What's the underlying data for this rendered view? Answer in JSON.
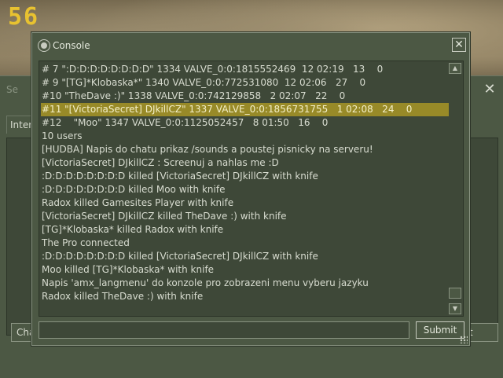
{
  "hud": {
    "number": "56"
  },
  "background_window": {
    "title": "Se",
    "tab_label": "Inter",
    "left_button_label": "Cha",
    "right_button_label": "t"
  },
  "console": {
    "title": "Console",
    "lines": [
      "# 7 \":D:D:D:D:D:D:D:D\" 1334 VALVE_0:0:1815552469  12 02:19   13    0",
      "# 9 \"[TG]*Klobaska*\" 1340 VALVE_0:0:772531080  12 02:06   27    0",
      "#10 \"TheDave :)\" 1338 VALVE_0:0:742129858   2 02:07   22    0",
      "#11 \"[VictoriaSecret] DJkillCZ\" 1337 VALVE_0:0:1856731755   1 02:08   24    0",
      "#12    \"Moo\" 1347 VALVE_0:0:1125052457   8 01:50   16    0",
      "10 users",
      "[HUDBA] Napis do chatu prikaz /sounds a poustej pisnicky na serveru!",
      "[VictoriaSecret] DJkillCZ : Screenuj a nahlas me :D",
      ":D:D:D:D:D:D:D:D killed [VictoriaSecret] DJkillCZ with knife",
      ":D:D:D:D:D:D:D:D killed Moo with knife",
      "Radox killed Gamesites Player with knife",
      "[VictoriaSecret] DJkillCZ killed TheDave :) with knife",
      "[TG]*Klobaska* killed Radox with knife",
      "The Pro connected",
      ":D:D:D:D:D:D:D:D killed [VictoriaSecret] DJkillCZ with knife",
      "Moo killed [TG]*Klobaska* with knife",
      "Napis 'amx_langmenu' do konzole pro zobrazeni menu vyberu jazyku",
      "Radox killed TheDave :) with knife"
    ],
    "highlighted_line_index": 3,
    "input_value": "",
    "submit_label": "Submit"
  },
  "icons": [
    "steam-icon",
    "close-icon",
    "scroll-up-icon",
    "scroll-down-icon",
    "resize-grip-icon"
  ],
  "colors": {
    "panel": "#4c5844",
    "highlight": "#988a28",
    "hud": "#e8c230"
  }
}
